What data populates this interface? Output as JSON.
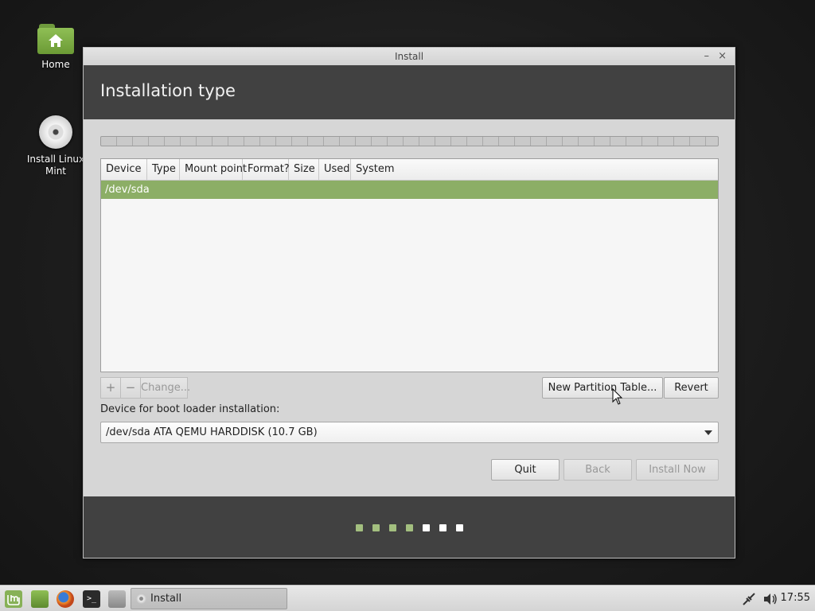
{
  "desktop": {
    "icons": [
      {
        "label": "Home"
      },
      {
        "label_line1": "Install Linux",
        "label_line2": "Mint"
      }
    ]
  },
  "window": {
    "title": "Install",
    "minimize": "–",
    "close": "×",
    "header": "Installation type"
  },
  "table": {
    "columns": [
      "Device",
      "Type",
      "Mount point",
      "Format?",
      "Size",
      "Used",
      "System"
    ],
    "rows": [
      {
        "device": "/dev/sda",
        "selected": true
      }
    ]
  },
  "toolbar": {
    "add": "+",
    "remove": "−",
    "change": "Change...",
    "new_partition_table": "New Partition Table...",
    "revert": "Revert"
  },
  "bootloader": {
    "label": "Device for boot loader installation:",
    "selected": "/dev/sda ATA QEMU HARDDISK (10.7 GB)"
  },
  "actions": {
    "quit": "Quit",
    "back": "Back",
    "install_now": "Install Now"
  },
  "progress": {
    "total_steps": 7,
    "completed_steps": 4,
    "completed_color": "#a3bf7f",
    "pending_color": "#ffffff"
  },
  "taskbar": {
    "task_label": "Install",
    "clock": "17:55"
  },
  "colors": {
    "accent": "#8cae66",
    "header_bg": "#414141"
  }
}
